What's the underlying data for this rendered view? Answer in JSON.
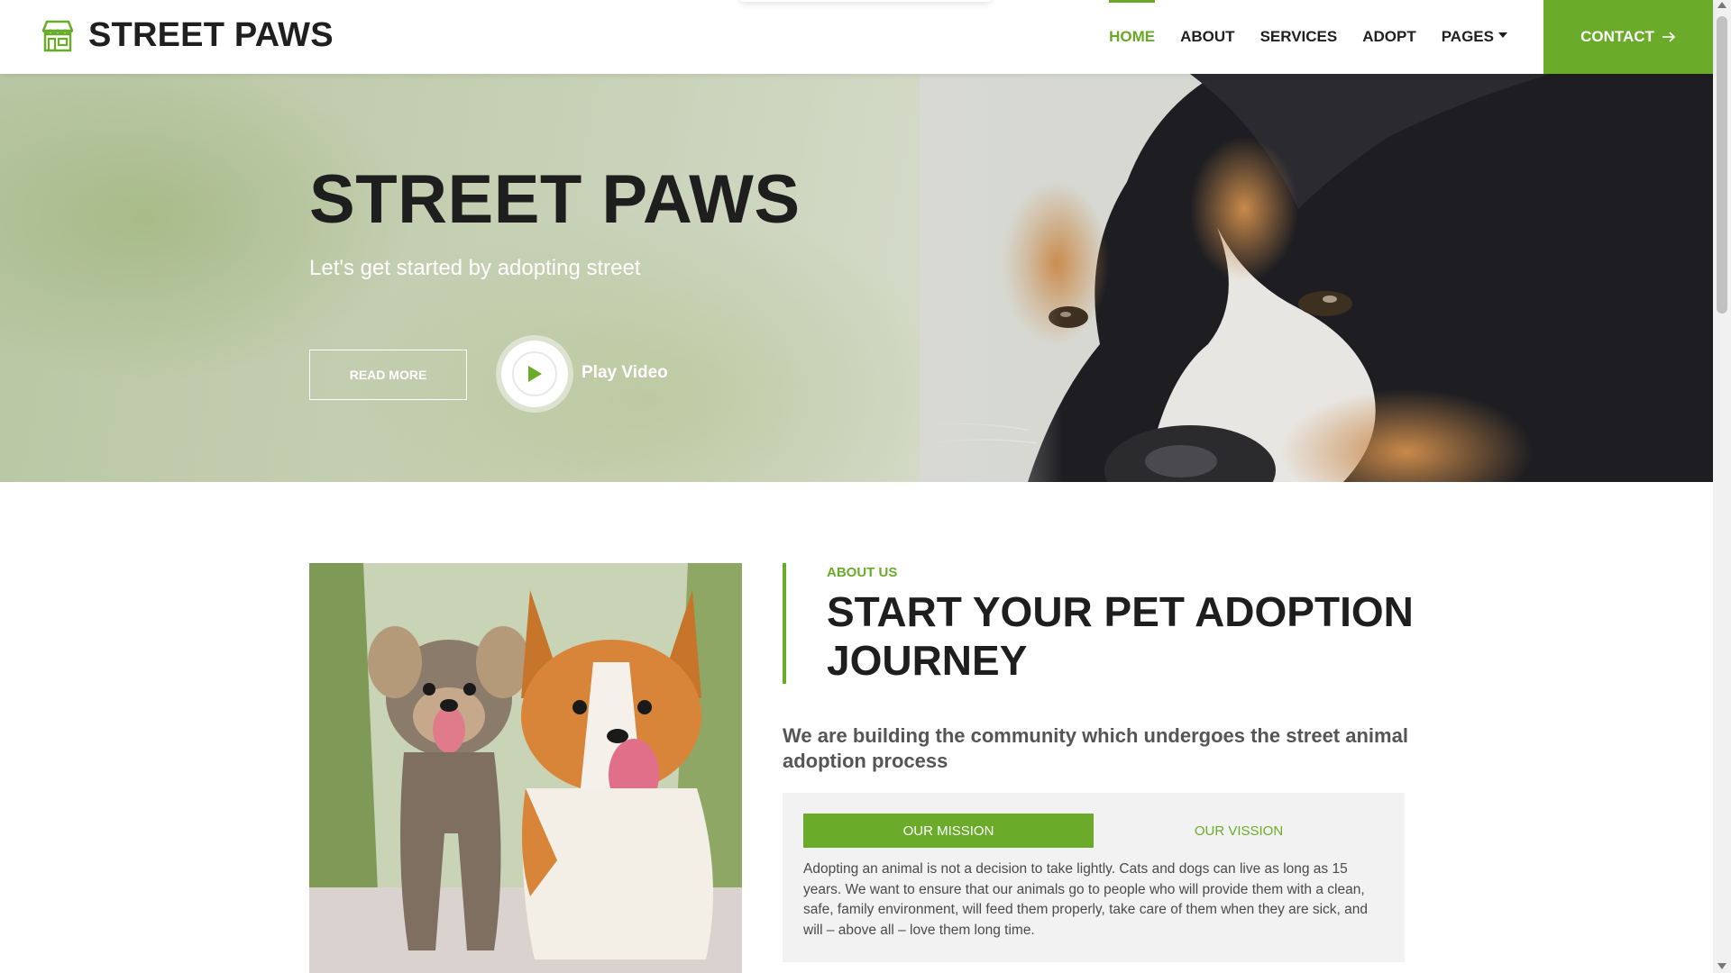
{
  "navbar": {
    "brand": "STREET PAWS",
    "brand_icon": "storefront-icon",
    "links": [
      {
        "label": "HOME",
        "active": true
      },
      {
        "label": "ABOUT",
        "active": false
      },
      {
        "label": "SERVICES",
        "active": false
      },
      {
        "label": "ADOPT",
        "active": false
      },
      {
        "label": "PAGES",
        "active": false,
        "dropdown": true
      }
    ],
    "contact_label": "CONTACT",
    "contact_icon": "arrow-right-icon"
  },
  "hero": {
    "title": "STREET PAWS",
    "subtitle": "Let's get started by adopting street",
    "read_more": "READ MORE",
    "play_video": "Play Video"
  },
  "about": {
    "kicker": "ABOUT US",
    "title": "START YOUR PET ADOPTION JOURNEY",
    "lead": "We are building the community which undergoes the street animal adoption process",
    "tabs": [
      {
        "label": "OUR MISSION",
        "active": true
      },
      {
        "label": "OUR VISSION",
        "active": false
      }
    ],
    "tab_text": "Adopting an animal is not a decision to take lightly. Cats and dogs can live as long as 15 years. We want to ensure that our animals go to people who will provide them with a clean, safe, family environment, will feed them properly, take care of them when they are sick, and will – above all – love them long time."
  },
  "colors": {
    "accent": "#6aac2a",
    "heading": "#1e1e1e",
    "panel": "#f2f2f2"
  }
}
